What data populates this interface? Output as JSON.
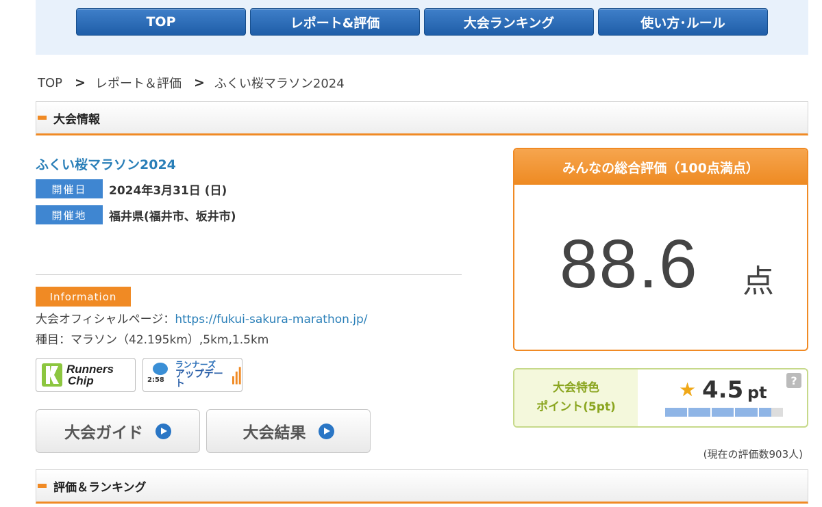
{
  "nav": {
    "items": [
      {
        "label": "TOP"
      },
      {
        "label": "レポート&評価"
      },
      {
        "label": "大会ランキング"
      },
      {
        "label": "使い方･ルール"
      }
    ]
  },
  "breadcrumb": {
    "items": [
      "TOP",
      "レポート＆評価",
      "ふくい桜マラソン2024"
    ],
    "separator": ">"
  },
  "section_event": {
    "title": "大会情報"
  },
  "event": {
    "name": "ふくい桜マラソン2024",
    "date_tag": "開催日",
    "date": "2024年3月31日 (日)",
    "place_tag": "開催地",
    "place": "福井県(福井市、坂井市)"
  },
  "information": {
    "badge": "Information",
    "official_label": "大会オフィシャルページ：",
    "official_url": "https://fukui-sakura-marathon.jp/",
    "events_line": "種目：マラソン（42.195km）,5km,1.5km"
  },
  "logos": {
    "runners_chip": {
      "line1": "Runners",
      "line2": "Chip"
    },
    "runners_update": {
      "line1": "ランナーズ",
      "line2": "アップデート",
      "small": "2:58"
    }
  },
  "buttons": {
    "guide": "大会ガイド",
    "results": "大会結果"
  },
  "score": {
    "header": "みんなの総合評価（100点満点）",
    "value": "88.6",
    "unit": "点"
  },
  "feature": {
    "label_line1": "大会特色",
    "label_line2": "ポイント(5pt)",
    "value": "4.5",
    "unit": "pt",
    "help": "?",
    "fraction": 0.9
  },
  "rating_count": "(現在の評価数903人)",
  "section_rating": {
    "title": "評価＆ランキング"
  },
  "colors": {
    "nav_blue": "#1f5ea8",
    "accent_orange": "#f08a24",
    "link_blue": "#2a7fb8",
    "feature_green": "#8aa51f"
  }
}
